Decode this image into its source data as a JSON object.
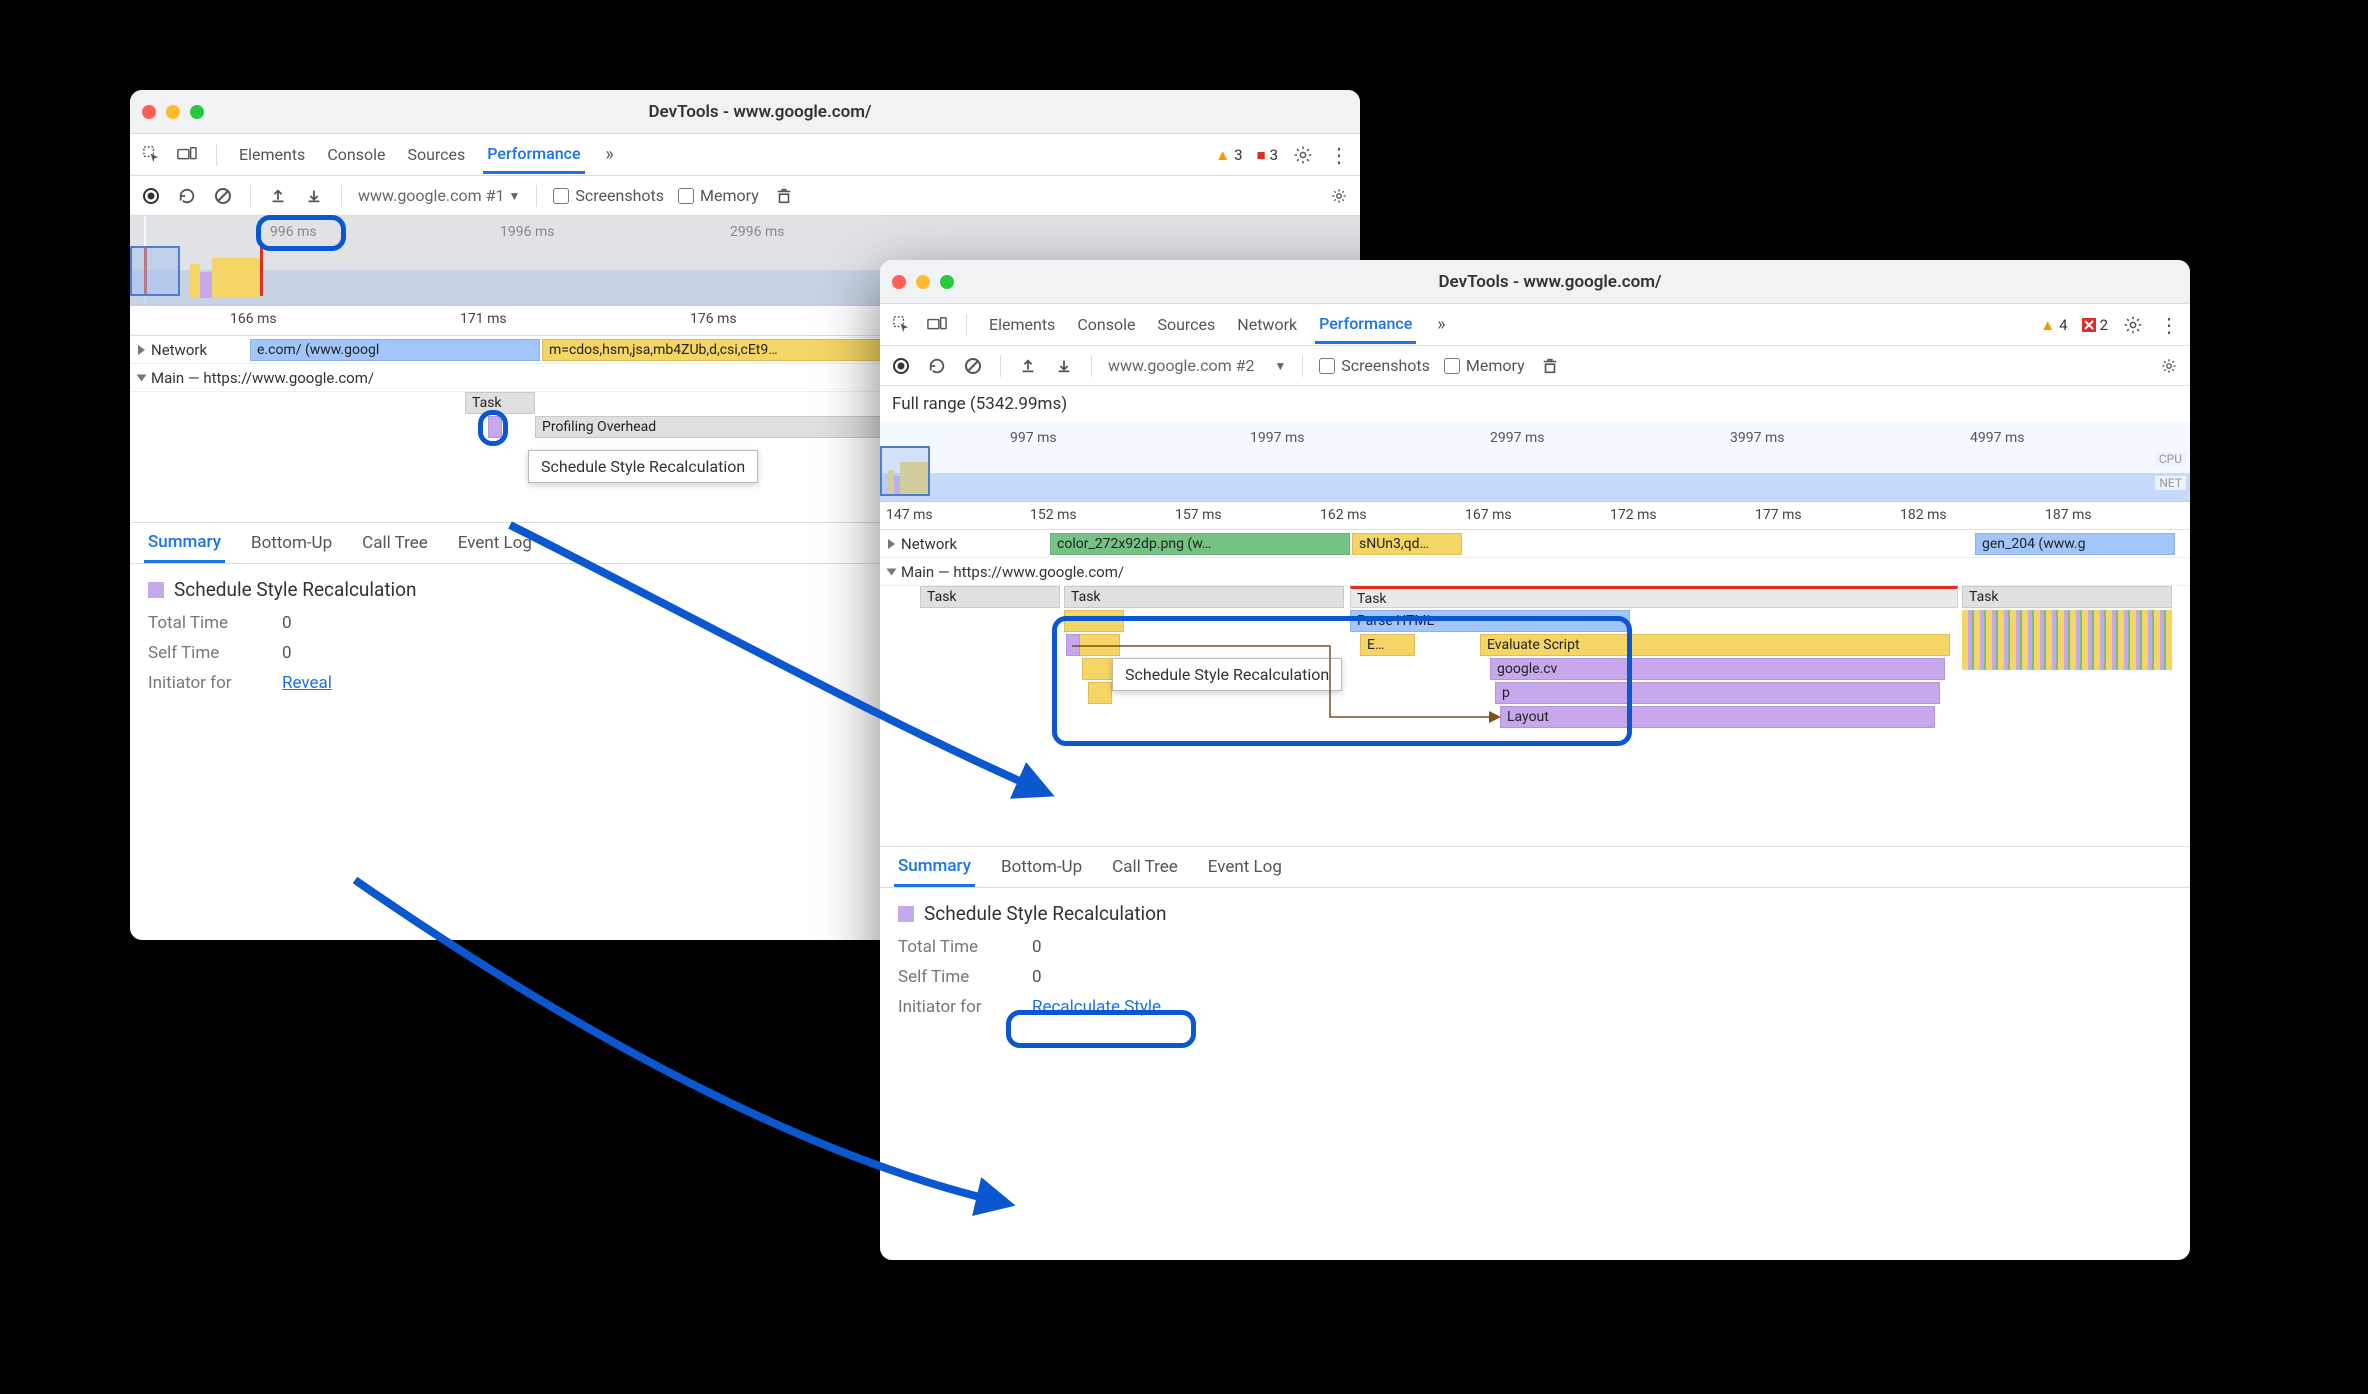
{
  "window1": {
    "title": "DevTools - www.google.com/",
    "tabs": [
      "Elements",
      "Console",
      "Sources",
      "Performance"
    ],
    "warn_count": "3",
    "err_count": "3",
    "toolbar": {
      "page_dropdown": "www.google.com #1",
      "screenshots": "Screenshots",
      "memory": "Memory"
    },
    "overview": {
      "t1": "996 ms",
      "t2": "1996 ms",
      "t3": "2996 ms"
    },
    "detail_times": {
      "t1": "166 ms",
      "t2": "171 ms",
      "t3": "176 ms"
    },
    "network_label": "Network",
    "net_item": "e.com/ (www.googl",
    "net_item2": "m=cdos,hsm,jsa,mb4ZUb,d,csi,cEt9…",
    "main_label": "Main — https://www.google.com/",
    "task": "Task",
    "prof": "Profiling Overhead",
    "tooltip": "Schedule Style Recalculation",
    "subtabs": [
      "Summary",
      "Bottom-Up",
      "Call Tree",
      "Event Log"
    ],
    "summary": {
      "title": "Schedule Style Recalculation",
      "total_time_k": "Total Time",
      "total_time_v": "0",
      "self_time_k": "Self Time",
      "self_time_v": "0",
      "initiator_k": "Initiator for",
      "reveal": "Reveal"
    }
  },
  "window2": {
    "title": "DevTools - www.google.com/",
    "tabs": [
      "Elements",
      "Console",
      "Sources",
      "Network",
      "Performance"
    ],
    "warn_count": "4",
    "err_count": "2",
    "toolbar": {
      "page_dropdown": "www.google.com #2",
      "screenshots": "Screenshots",
      "memory": "Memory"
    },
    "range": "Full range (5342.99ms)",
    "overview": {
      "t1": "997 ms",
      "t2": "1997 ms",
      "t3": "2997 ms",
      "t4": "3997 ms",
      "t5": "4997 ms",
      "cpu": "CPU",
      "net": "NET"
    },
    "detail_times": {
      "t0": "147 ms",
      "t1": "152 ms",
      "t2": "157 ms",
      "t3": "162 ms",
      "t4": "167 ms",
      "t5": "172 ms",
      "t6": "177 ms",
      "t7": "182 ms",
      "t8": "187 ms"
    },
    "network_label": "Network",
    "net_items": {
      "a": "color_272x92dp.png (w…",
      "b": "sNUn3,qd…",
      "c": "gen_204 (www.g"
    },
    "main_label": "Main — https://www.google.com/",
    "blocks": {
      "task": "Task",
      "parse": "Parse HTML",
      "ev": "E…",
      "eval": "Evaluate Script",
      "gcv": "google.cv",
      "p": "p",
      "layout": "Layout"
    },
    "tooltip": "Schedule Style Recalculation",
    "subtabs": [
      "Summary",
      "Bottom-Up",
      "Call Tree",
      "Event Log"
    ],
    "summary": {
      "title": "Schedule Style Recalculation",
      "total_time_k": "Total Time",
      "total_time_v": "0",
      "self_time_k": "Self Time",
      "self_time_v": "0",
      "initiator_k": "Initiator for",
      "reveal": "Recalculate Style"
    }
  }
}
